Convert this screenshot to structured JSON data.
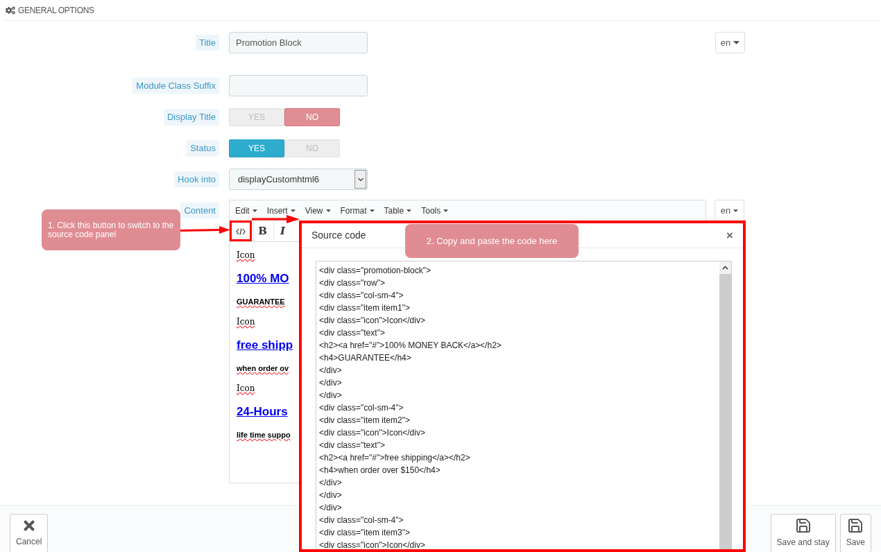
{
  "section_title": "GENERAL OPTIONS",
  "fields": [
    {
      "kind": "text",
      "label": "Title",
      "value": "Promotion Block",
      "language": "en"
    },
    {
      "kind": "text",
      "label": "Module Class Suffix"
    },
    {
      "kind": "toggle",
      "label": "Display Title",
      "options": [
        {
          "label": "YES",
          "selected": false
        },
        {
          "label": "NO",
          "selected": true
        }
      ]
    },
    {
      "kind": "toggle",
      "label": "Status",
      "options": [
        {
          "label": "YES",
          "selected": true
        },
        {
          "label": "NO",
          "selected": false
        }
      ]
    },
    {
      "kind": "select",
      "label": "Hook into",
      "value": "displayCustomhtml6"
    },
    {
      "kind": "editor",
      "label": "Content",
      "language": "en",
      "menus": [
        "Edit",
        "Insert",
        "View",
        "Format",
        "Table",
        "Tools"
      ],
      "toolbar": [
        "B",
        "I"
      ],
      "content": [
        {
          "kind": "plain",
          "text": "Icon"
        },
        {
          "kind": "link",
          "text": "100% MO"
        },
        {
          "kind": "bold",
          "text": "GUARANTEE"
        },
        {
          "kind": "plain",
          "text": "Icon"
        },
        {
          "kind": "link",
          "text": "free shipp"
        },
        {
          "kind": "bold",
          "text": "when order ov"
        },
        {
          "kind": "plain",
          "text": "Icon"
        },
        {
          "kind": "link",
          "text": "24-Hours"
        },
        {
          "kind": "bold",
          "text": "life time suppo"
        }
      ]
    }
  ],
  "source_dialog": {
    "title": "Source code",
    "close": "×",
    "lines": [
      "<div class=\"promotion-block\">",
      "<div class=\"row\">",
      "<div class=\"col-sm-4\">",
      "<div class=\"item item1\">",
      "<div class=\"icon\">Icon</div>",
      "<div class=\"text\">",
      "<h2><a href=\"#\">100% MONEY BACK</a></h2>",
      "<h4>GUARANTEE</h4>",
      "</div>",
      "</div>",
      "</div>",
      "<div class=\"col-sm-4\">",
      "<div class=\"item item2\">",
      "<div class=\"icon\">Icon</div>",
      "<div class=\"text\">",
      "<h2><a href=\"#\">free shipping</a></h2>",
      "<h4>when order over $150</h4>",
      "</div>",
      "</div>",
      "</div>",
      "<div class=\"col-sm-4\">",
      "<div class=\"item item3\">",
      "<div class=\"icon\">Icon</div>"
    ]
  },
  "callouts": [
    "1. Click this button to switch to the source code panel",
    "2. Copy and paste the code here"
  ],
  "footer": {
    "buttons": [
      {
        "kind": "cancel",
        "label": "Cancel"
      },
      {
        "kind": "save",
        "label": "Save and stay"
      },
      {
        "kind": "save",
        "label": "Save"
      }
    ]
  }
}
